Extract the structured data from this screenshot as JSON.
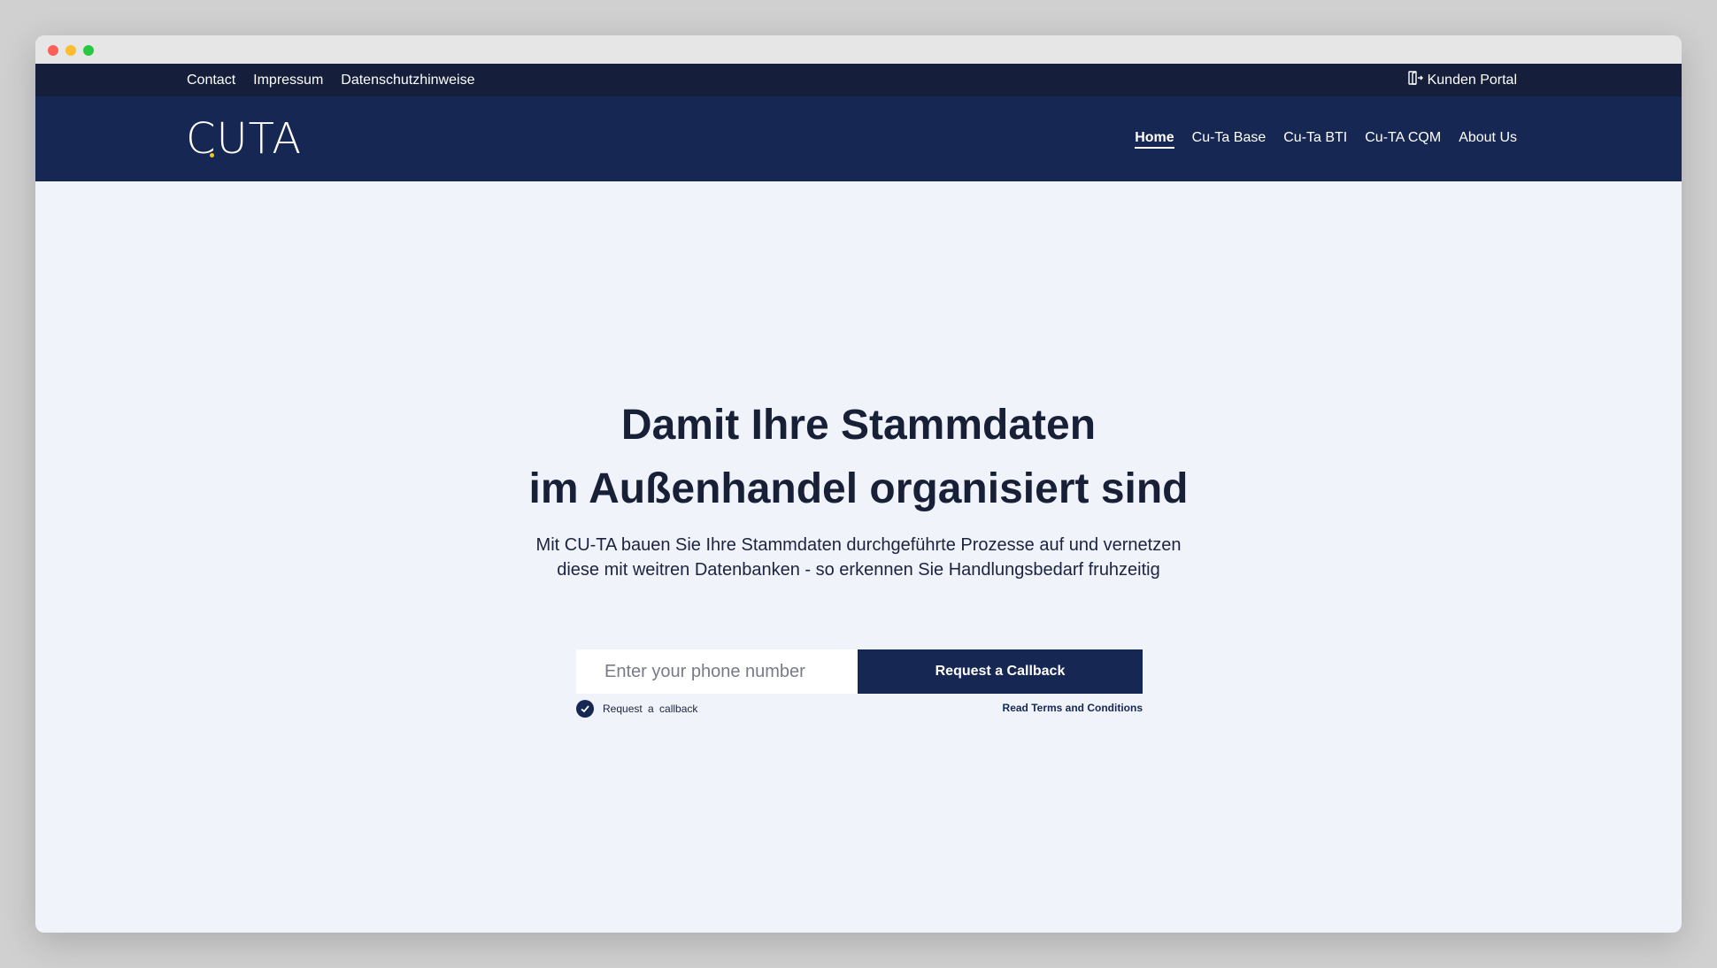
{
  "topbar": {
    "links": [
      "Contact",
      "Impressum",
      "Datenschutzhinweise"
    ],
    "portal_label": "Kunden Portal",
    "portal_icon": "door-exit-icon"
  },
  "navbar": {
    "logo_text": "CUTA",
    "items": [
      {
        "label": "Home",
        "active": true
      },
      {
        "label": "Cu-Ta Base",
        "active": false
      },
      {
        "label": "Cu-Ta BTI",
        "active": false
      },
      {
        "label": "Cu-TA CQM",
        "active": false
      },
      {
        "label": "About Us",
        "active": false
      }
    ]
  },
  "hero": {
    "headline_line1": "Damit Ihre Stammdaten",
    "headline_line2": "im Außenhandel organisiert sind",
    "subtext": "Mit CU-TA bauen Sie Ihre Stammdaten durchgeführte Prozesse auf und vernetzen diese mit weitren Datenbanken - so erkennen Sie Handlungsbedarf fruhzeitig",
    "phone_placeholder": "Enter your phone number",
    "phone_value": "",
    "button_label": "Request a Callback",
    "checkbox_label": "Request a callback",
    "checkbox_checked": true,
    "terms_label": "Read Terms and Conditions"
  },
  "colors": {
    "topbar": "#151e3b",
    "navbar": "#172753",
    "page_bg": "#f0f3f9",
    "heading_text": "#172037",
    "logo_accent": "#f6c416"
  }
}
